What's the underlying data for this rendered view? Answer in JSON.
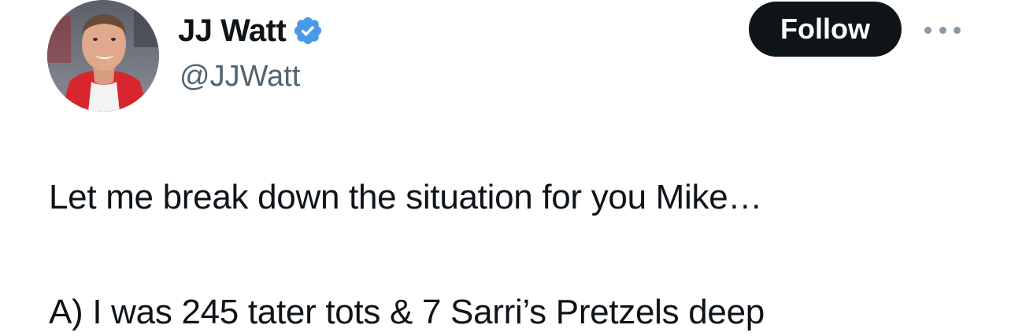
{
  "user": {
    "display_name": "JJ Watt",
    "handle": "@JJWatt",
    "verified": true,
    "verified_color": "#4a99e9"
  },
  "actions": {
    "follow_label": "Follow",
    "more_icon": "more-horizontal-icon"
  },
  "tweet": {
    "lines": [
      "Let me break down the situation for you Mike…",
      "A) I was 245 tater tots & 7 Sarri’s Pretzels deep"
    ]
  },
  "colors": {
    "text": "#0f1419",
    "secondary_text": "#536471",
    "button_bg": "#0f1419",
    "button_text": "#ffffff"
  }
}
